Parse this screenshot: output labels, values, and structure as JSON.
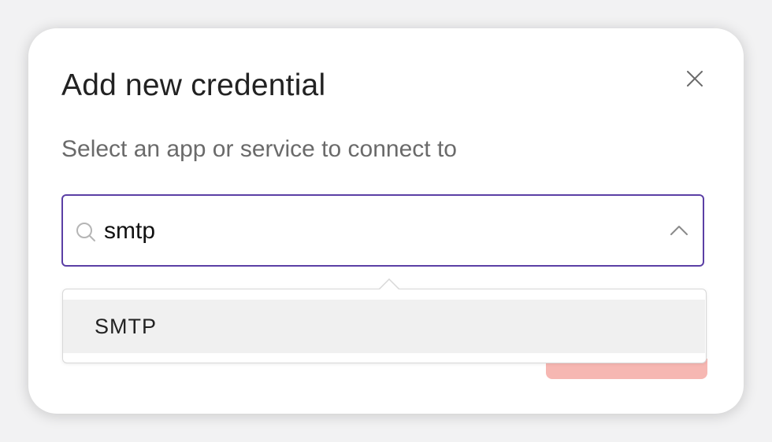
{
  "dialog": {
    "title": "Add new credential",
    "subtitle": "Select an app or service to connect to",
    "close_icon": "close-icon"
  },
  "search": {
    "value": "smtp",
    "icon": "search-icon",
    "toggle_icon": "chevron-up-icon"
  },
  "dropdown": {
    "options": [
      {
        "label": "SMTP",
        "highlighted": true
      }
    ]
  },
  "colors": {
    "accent": "#5b3fa5",
    "primary_button_disabled": "#f6b7b2",
    "option_highlight": "#f0f0f0"
  }
}
